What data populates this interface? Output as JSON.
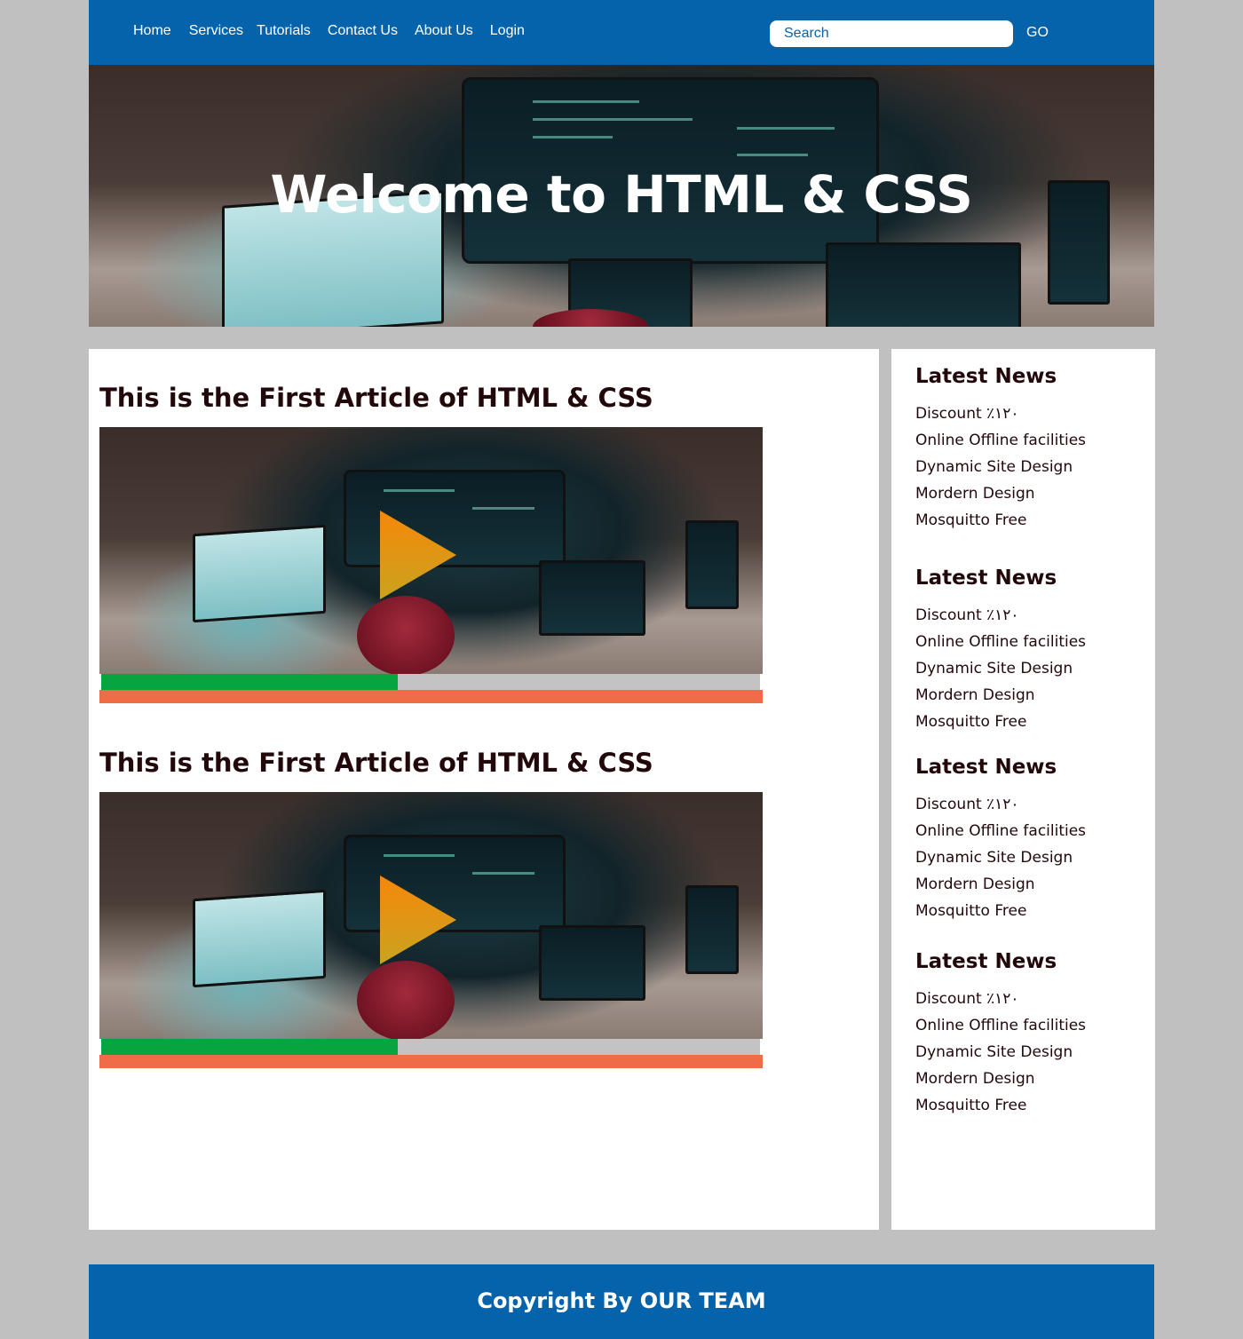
{
  "nav": {
    "items": [
      {
        "label": "Home"
      },
      {
        "label": "Services"
      },
      {
        "label": "Tutorials"
      },
      {
        "label": "Contact Us"
      },
      {
        "label": "About Us"
      },
      {
        "label": "Login"
      }
    ],
    "search_placeholder": "Search",
    "go_label": "GO"
  },
  "hero": {
    "title": "Welcome to HTML & CSS",
    "image": "office-desk-monitors-photo"
  },
  "articles": [
    {
      "title": "This is the First Article of HTML & CSS",
      "video": {
        "thumbnail": "office-desk-monitors-photo",
        "progress": 0.45,
        "play_icon": "play-icon",
        "play_color": "#f08a0a"
      }
    },
    {
      "title": "This is the First Article of HTML & CSS",
      "video": {
        "thumbnail": "office-desk-monitors-photo",
        "progress": 0.45,
        "play_icon": "play-icon",
        "play_color": "#f08a0a"
      }
    }
  ],
  "sidebar": {
    "groups": [
      {
        "title": "Latest News",
        "items": [
          "Discount ٪١٢٠",
          "Online Offline facilities",
          "Dynamic Site Design",
          "Mordern Design",
          "Mosquitto Free"
        ]
      },
      {
        "title": "Latest News",
        "items": [
          "Discount ٪١٢٠",
          "Online Offline facilities",
          "Dynamic Site Design",
          "Mordern Design",
          "Mosquitto Free"
        ]
      },
      {
        "title": "Latest News",
        "items": [
          "Discount ٪١٢٠",
          "Online Offline facilities",
          "Dynamic Site Design",
          "Mordern Design",
          "Mosquitto Free"
        ]
      },
      {
        "title": "Latest News",
        "items": [
          "Discount ٪١٢٠",
          "Online Offline facilities",
          "Dynamic Site Design",
          "Mordern Design",
          "Mosquitto Free"
        ]
      }
    ]
  },
  "footer": {
    "copyright": "Copyright By OUR TEAM"
  },
  "colors": {
    "brand_blue": "#0563ac",
    "progress_green": "#07a43f",
    "progress_track": "#c3c3c3",
    "control_orange": "#ee6d48",
    "page_bg": "#c0c0c0"
  }
}
